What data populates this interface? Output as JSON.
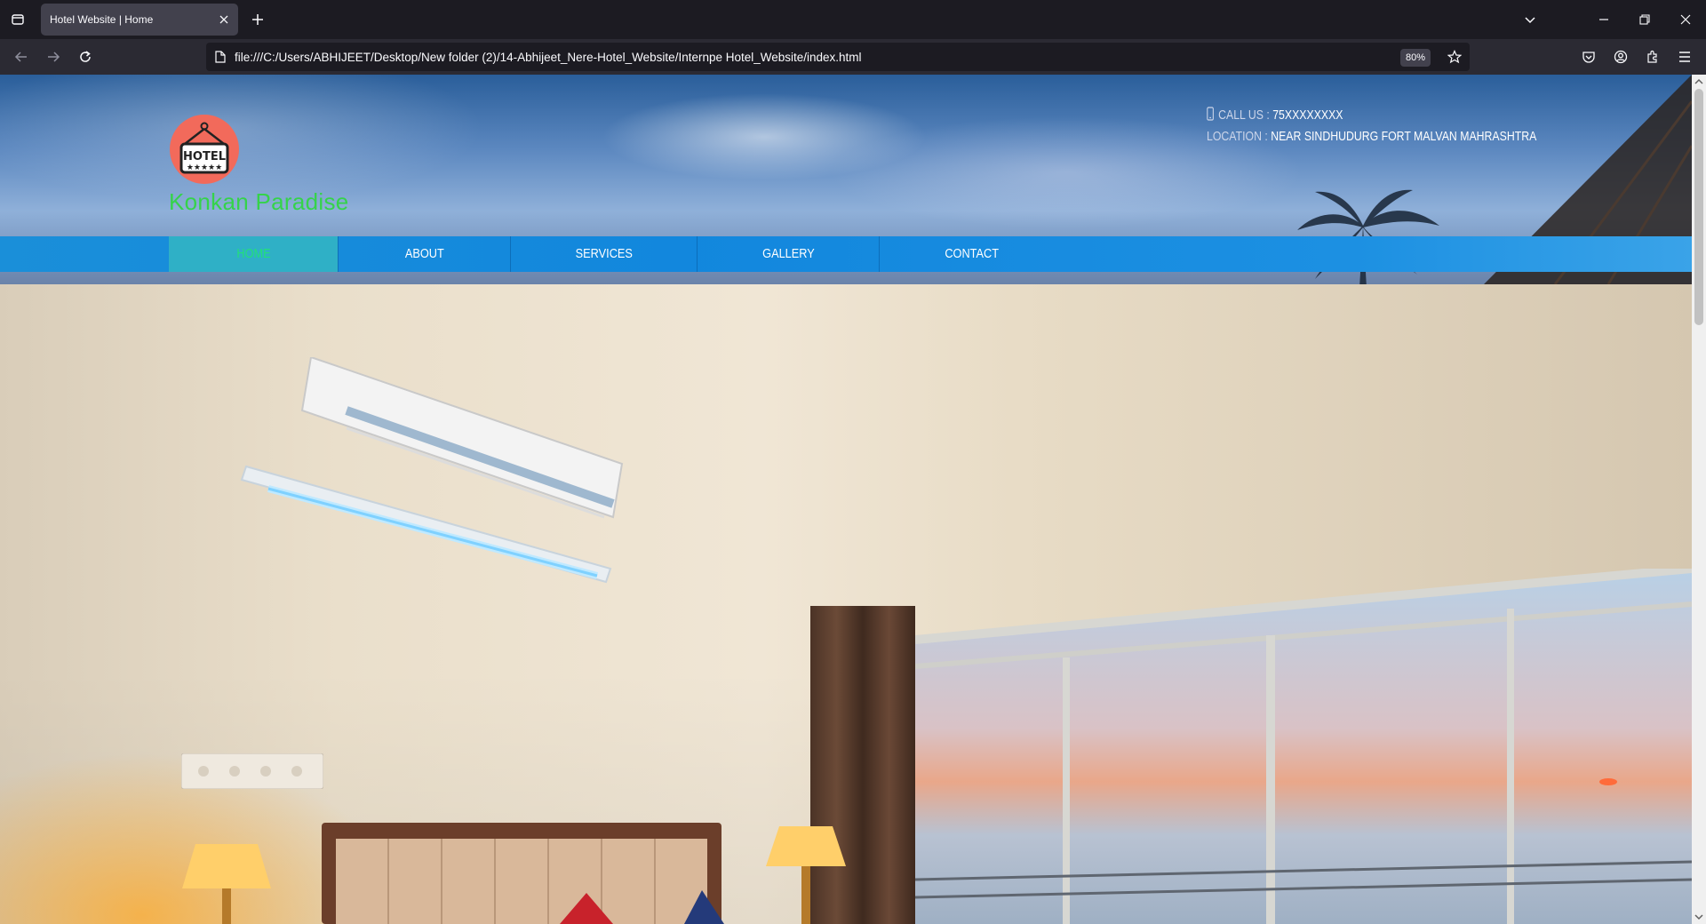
{
  "browser": {
    "tab": {
      "title": "Hotel Website | Home"
    },
    "url": "file:///C:/Users/ABHIJEET/Desktop/New folder (2)/14-Abhijeet_Nere-Hotel_Website/Internpe Hotel_Website/index.html",
    "zoom": "80%"
  },
  "site": {
    "logo_text": "HOTEL",
    "name": "Konkan Paradise",
    "contact": {
      "call_label": "CALL US :",
      "call_value": "75XXXXXXXX",
      "location_label": "LOCATION :",
      "location_value": "NEAR SINDHUDURG FORT MALVAN MAHRASHTRA"
    },
    "menu": [
      {
        "label": "HOME",
        "active": true
      },
      {
        "label": "ABOUT",
        "active": false
      },
      {
        "label": "SERVICES",
        "active": false
      },
      {
        "label": "GALLERY",
        "active": false
      },
      {
        "label": "CONTACT",
        "active": false
      }
    ]
  },
  "colors": {
    "brand_green": "#35d34a",
    "menu_blue": "#1287dd",
    "menu_active": "#2fb0c6"
  }
}
